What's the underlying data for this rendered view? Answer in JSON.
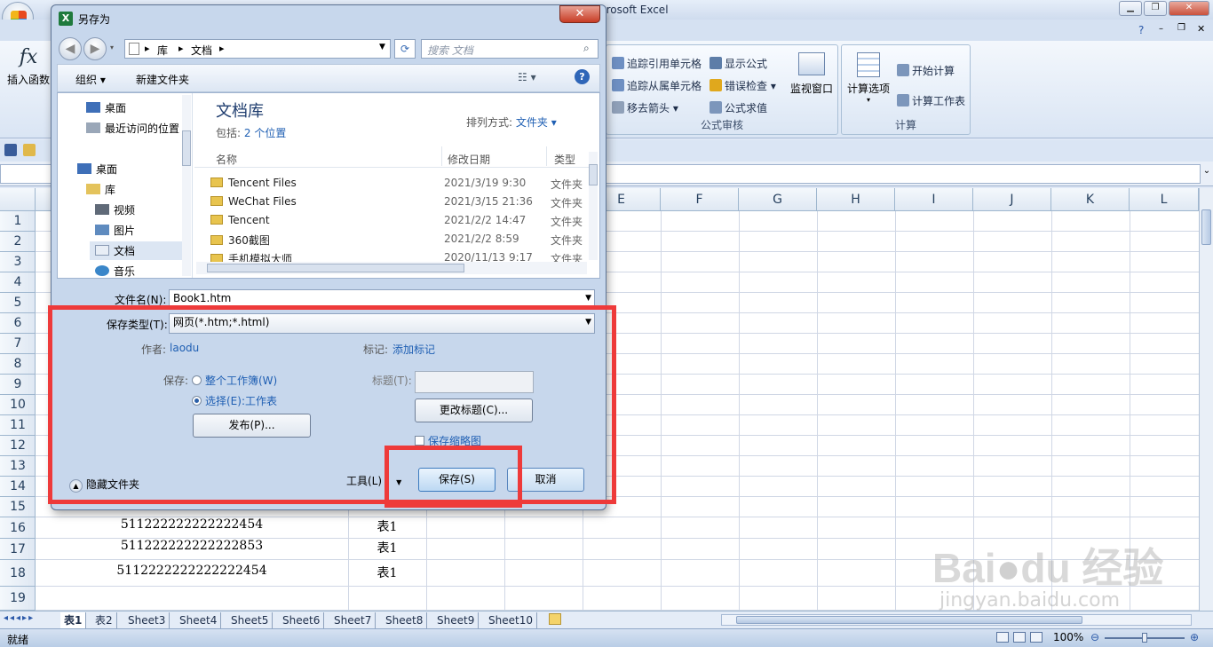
{
  "excel": {
    "title": "crosoft Excel",
    "ribbon": {
      "insert_function": "插入函数",
      "audit_items": [
        "追踪引用单元格",
        "追踪从属单元格",
        "移去箭头",
        "显示公式",
        "错误检查",
        "公式求值"
      ],
      "watch_window": "监视窗口",
      "audit_group": "公式审核",
      "calc_options": "计算选项",
      "calc_now": "开始计算",
      "calc_sheet": "计算工作表",
      "calc_group": "计算"
    },
    "columns": [
      "E",
      "F",
      "G",
      "H",
      "I",
      "J",
      "K",
      "L"
    ],
    "rows": [
      "1",
      "2",
      "3",
      "4",
      "5",
      "6",
      "7",
      "8",
      "9",
      "10",
      "11",
      "12",
      "13",
      "14",
      "15",
      "16",
      "17",
      "18",
      "19"
    ],
    "cells": [
      {
        "id": "B16",
        "value": "511222222222222454"
      },
      {
        "id": "C16",
        "value": "表1"
      },
      {
        "id": "B17",
        "value": "511222222222222853"
      },
      {
        "id": "C17",
        "value": "表1"
      },
      {
        "id": "B18",
        "value": "5112222222222222454"
      },
      {
        "id": "C18",
        "value": "表1"
      }
    ],
    "sheet_tabs": [
      "表1",
      "表2",
      "Sheet3",
      "Sheet4",
      "Sheet5",
      "Sheet6",
      "Sheet7",
      "Sheet8",
      "Sheet9",
      "Sheet10"
    ],
    "status": "就绪",
    "zoom": "100%"
  },
  "dialog": {
    "title": "另存为",
    "breadcrumb": [
      "库",
      "文档"
    ],
    "search_placeholder": "搜索 文档",
    "organize": "组织",
    "new_folder": "新建文件夹",
    "nav_items": [
      "桌面",
      "最近访问的位置",
      "桌面",
      "库",
      "视频",
      "图片",
      "文档",
      "音乐"
    ],
    "library_title": "文档库",
    "includes_label": "包括:",
    "includes_link": "2 个位置",
    "sort_label": "排列方式:",
    "sort_value": "文件夹",
    "col_name": "名称",
    "col_date": "修改日期",
    "col_type": "类型",
    "files": [
      {
        "name": "Tencent Files",
        "date": "2021/3/19 9:30",
        "type": "文件夹"
      },
      {
        "name": "WeChat Files",
        "date": "2021/3/15 21:36",
        "type": "文件夹"
      },
      {
        "name": "Tencent",
        "date": "2021/2/2 14:47",
        "type": "文件夹"
      },
      {
        "name": "360截图",
        "date": "2021/2/2 8:59",
        "type": "文件夹"
      },
      {
        "name": "手机模拟大师",
        "date": "2020/11/13 9:17",
        "type": "文件夹"
      }
    ],
    "filename_label": "文件名(N):",
    "filename_value": "Book1.htm",
    "filetype_label": "保存类型(T):",
    "filetype_value": "网页(*.htm;*.html)",
    "author_label": "作者:",
    "author_value": "laodu",
    "tags_label": "标记:",
    "tags_value": "添加标记",
    "save_label": "保存:",
    "save_opt1": "整个工作簿(W)",
    "save_opt2": "选择(E):工作表",
    "publish": "发布(P)...",
    "title_label": "标题(T):",
    "change_title": "更改标题(C)...",
    "thumbnail": "保存缩略图",
    "hide_folders": "隐藏文件夹",
    "tools": "工具(L)",
    "save_btn": "保存(S)",
    "cancel_btn": "取消"
  },
  "colors": {
    "highlight": "#ee3a3a",
    "link": "#1f5fb3"
  }
}
